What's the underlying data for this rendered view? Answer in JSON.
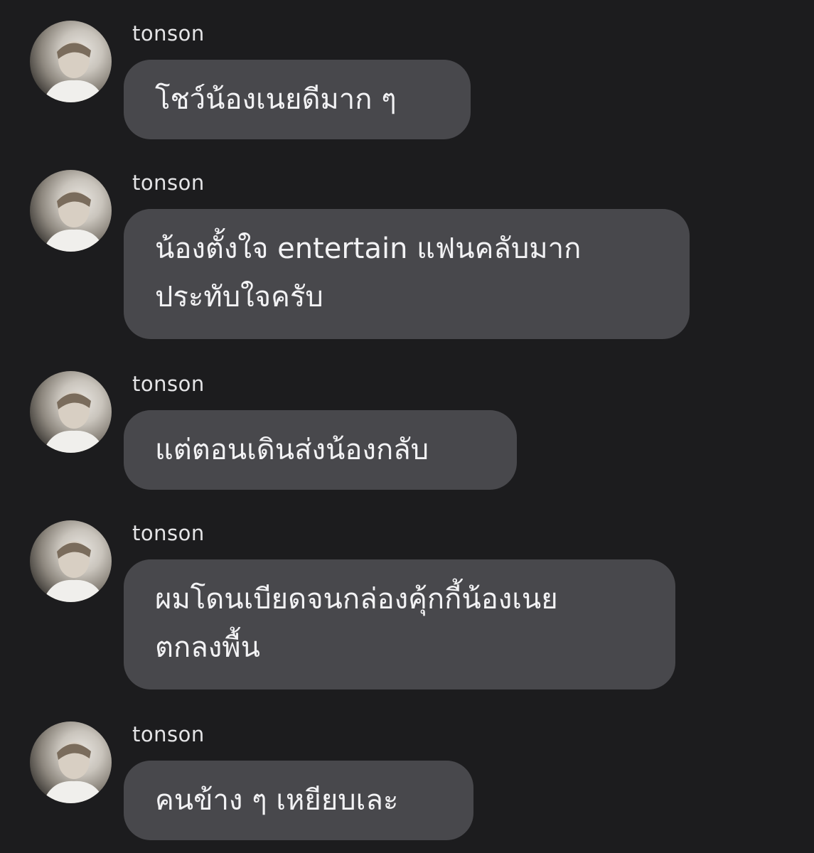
{
  "messages": [
    {
      "sender": "tonson",
      "avatar_icon": "user-avatar-icon",
      "text": "โชว์น้องเนยดีมาก ๆ"
    },
    {
      "sender": "tonson",
      "avatar_icon": "user-avatar-icon",
      "text": "น้องตั้งใจ entertain แฟนคลับมาก\nประทับใจครับ"
    },
    {
      "sender": "tonson",
      "avatar_icon": "user-avatar-icon",
      "text": "แต่ตอนเดินส่งน้องกลับ"
    },
    {
      "sender": "tonson",
      "avatar_icon": "user-avatar-icon",
      "text": "ผมโดนเบียดจนกล่องคุ้กกี้น้องเนย\nตกลงพื้น"
    },
    {
      "sender": "tonson",
      "avatar_icon": "user-avatar-icon",
      "text": "คนข้าง ๆ เหยียบเละ"
    }
  ],
  "colors": {
    "background": "#1c1c1e",
    "bubble": "#48484c",
    "text": "#f2f2f4",
    "sender_text": "#e4e4e6"
  }
}
